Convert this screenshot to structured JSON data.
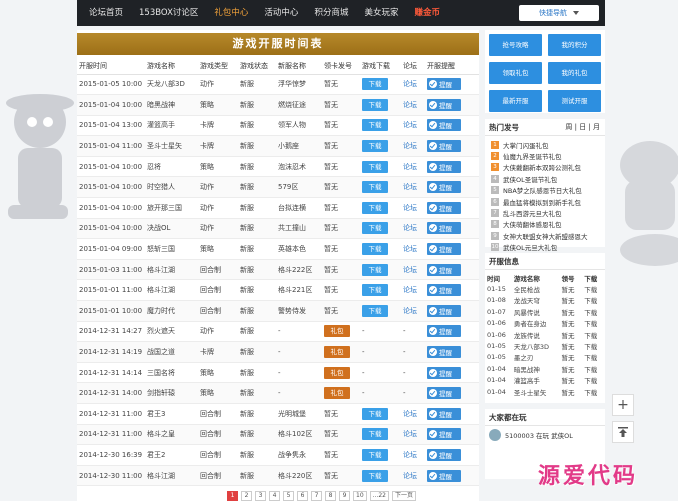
{
  "nav": {
    "items": [
      {
        "label": "论坛首页",
        "state": ""
      },
      {
        "label": "153BOX讨论区",
        "state": ""
      },
      {
        "label": "礼包中心",
        "state": "active"
      },
      {
        "label": "活动中心",
        "state": ""
      },
      {
        "label": "积分商城",
        "state": ""
      },
      {
        "label": "美女玩家",
        "state": ""
      },
      {
        "label": "赚金币",
        "state": "hot"
      }
    ],
    "quick_nav": "快捷导航"
  },
  "banner": "游戏开服时间表",
  "table": {
    "headers": [
      "开服时间",
      "游戏名称",
      "游戏类型",
      "游戏状态",
      "新服名称",
      "领卡发号",
      "游戏下载",
      "论坛",
      "开服提醒"
    ],
    "rows": [
      [
        "2015-01-05 10:00",
        "天龙八部3D",
        "动作",
        "新服",
        "浮华惊梦",
        "暂无",
        "下载",
        "论坛",
        "提醒"
      ],
      [
        "2015-01-04 10:00",
        "暗黑战神",
        "策略",
        "新服",
        "燃烧征途",
        "暂无",
        "下载",
        "论坛",
        "提醒"
      ],
      [
        "2015-01-04 13:00",
        "灌篮高手",
        "卡牌",
        "新服",
        "领军人物",
        "暂无",
        "下载",
        "论坛",
        "提醒"
      ],
      [
        "2015-01-04 11:00",
        "圣斗士星矢",
        "卡牌",
        "新服",
        "小鹅座",
        "暂无",
        "下载",
        "论坛",
        "提醒"
      ],
      [
        "2015-01-04 10:00",
        "忍将",
        "策略",
        "新服",
        "泡沫忍术",
        "暂无",
        "下载",
        "论坛",
        "提醒"
      ],
      [
        "2015-01-04 10:00",
        "时空猎人",
        "动作",
        "新服",
        "579区",
        "暂无",
        "下载",
        "论坛",
        "提醒"
      ],
      [
        "2015-01-04 10:00",
        "旅开那三国",
        "动作",
        "新服",
        "台拟连横",
        "暂无",
        "下载",
        "论坛",
        "提醒"
      ],
      [
        "2015-01-04 10:00",
        "决战OL",
        "动作",
        "新服",
        "共工撞山",
        "暂无",
        "下载",
        "论坛",
        "提醒"
      ],
      [
        "2015-01-04 09:00",
        "怒斩三国",
        "策略",
        "新服",
        "英雄本色",
        "暂无",
        "下载",
        "论坛",
        "提醒"
      ],
      [
        "2015-01-03 11:00",
        "格斗江湖",
        "回合制",
        "新服",
        "格斗222区",
        "暂无",
        "下载",
        "论坛",
        "提醒"
      ],
      [
        "2015-01-01 11:00",
        "格斗江湖",
        "回合制",
        "新服",
        "格斗221区",
        "暂无",
        "下载",
        "论坛",
        "提醒"
      ],
      [
        "2015-01-01 10:00",
        "魔力时代",
        "回合制",
        "新服",
        "警势侍发",
        "暂无",
        "下载",
        "论坛",
        "提醒"
      ],
      [
        "2014-12-31 14:27",
        "烈火遮天",
        "动作",
        "新服",
        "-",
        "礼包",
        "-",
        "-",
        "提醒"
      ],
      [
        "2014-12-31 14:19",
        "战国之道",
        "卡牌",
        "新服",
        "-",
        "礼包",
        "-",
        "-",
        "提醒"
      ],
      [
        "2014-12-31 14:14",
        "三国名将",
        "策略",
        "新服",
        "-",
        "礼包",
        "-",
        "-",
        "提醒"
      ],
      [
        "2014-12-31 14:00",
        "剑指轩辕",
        "策略",
        "新服",
        "-",
        "礼包",
        "-",
        "-",
        "提醒"
      ],
      [
        "2014-12-31 11:00",
        "君王3",
        "回合制",
        "新服",
        "光明城堡",
        "暂无",
        "下载",
        "论坛",
        "提醒"
      ],
      [
        "2014-12-31 11:00",
        "格斗之皇",
        "回合制",
        "新服",
        "格斗102区",
        "暂无",
        "下载",
        "论坛",
        "提醒"
      ],
      [
        "2014-12-30 16:39",
        "君王2",
        "回合制",
        "新服",
        "战争隽永",
        "暂无",
        "下载",
        "论坛",
        "提醒"
      ],
      [
        "2014-12-30 11:00",
        "格斗江湖",
        "回合制",
        "新服",
        "格斗220区",
        "暂无",
        "下载",
        "论坛",
        "提醒"
      ]
    ]
  },
  "pager": [
    "1",
    "2",
    "3",
    "4",
    "5",
    "6",
    "7",
    "8",
    "9",
    "10",
    "...22",
    "下一页"
  ],
  "side": {
    "buttons": [
      "抢号攻略",
      "我的积分",
      "领取礼包",
      "我的礼包",
      "最新开服",
      "测试开服"
    ],
    "hot_title": "热门发号",
    "hot_tabs": "周 | 日 | 月",
    "hot": [
      "大掌门闪蛋礼包",
      "仙魔九界圣诞节礼包",
      "大侠戴翻新本双跨公测礼包",
      "武侠OL圣诞节礼包",
      "NBA梦之队感恩节日大礼包",
      "最血猛将模拟到到新手礼包",
      "乱斗西游元旦大礼包",
      "大侠萌翻体感恩礼包",
      "女神大联盟女神大新盟感恩大",
      "武侠OL元旦大礼包"
    ],
    "kf_title": "开服信息",
    "kf_headers": [
      "时间",
      "游戏名称",
      "领号",
      "下载"
    ],
    "kf_rows": [
      [
        "01-15",
        "全民枪战",
        "暂无",
        "下载"
      ],
      [
        "01-08",
        "龙战天穹",
        "暂无",
        "下载"
      ],
      [
        "01-07",
        "风暴传说",
        "暂无",
        "下载"
      ],
      [
        "01-06",
        "勇者在身边",
        "暂无",
        "下载"
      ],
      [
        "01-06",
        "龙族传说",
        "暂无",
        "下载"
      ],
      [
        "01-05",
        "天龙八部3D",
        "暂无",
        "下载"
      ],
      [
        "01-05",
        "墨之刃",
        "暂无",
        "下载"
      ],
      [
        "01-04",
        "暗黑战神",
        "暂无",
        "下载"
      ],
      [
        "01-04",
        "灌篮高手",
        "暂无",
        "下载"
      ],
      [
        "01-04",
        "圣斗士星矢",
        "暂无",
        "下载"
      ]
    ],
    "playing_title": "大家都在玩",
    "playing": "5100003 在玩 武侠OL"
  },
  "watermark": "源爱代码"
}
